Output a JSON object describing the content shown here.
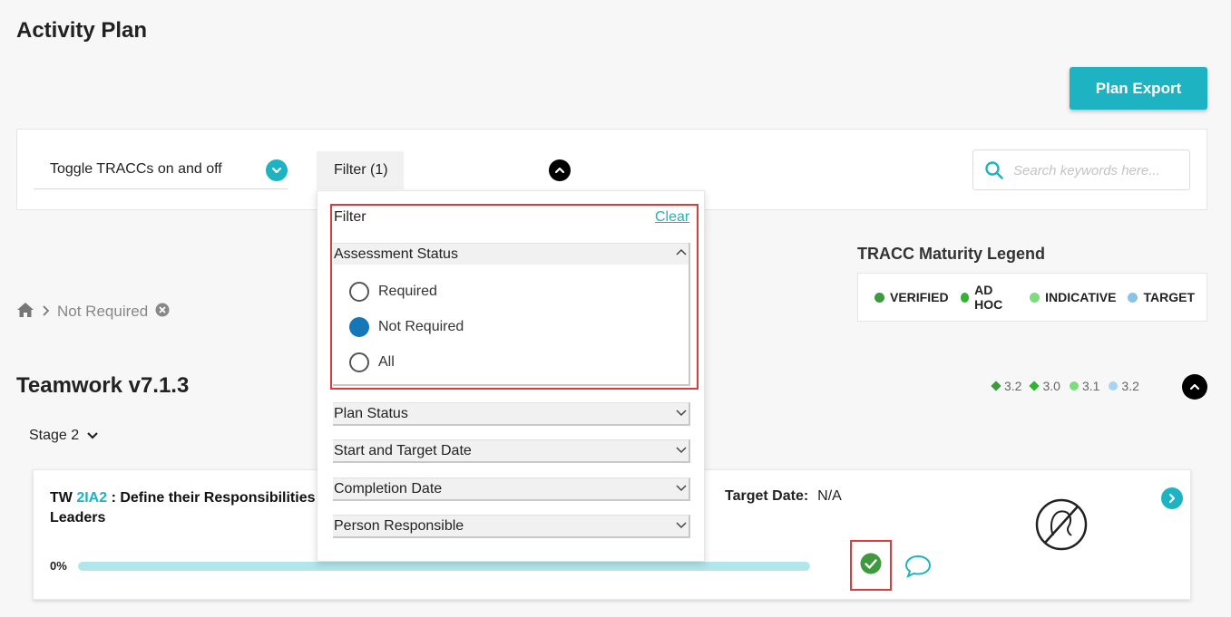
{
  "page": {
    "title": "Activity Plan",
    "export_label": "Plan Export"
  },
  "toolbar": {
    "toggle_label": "Toggle TRACCs on and off",
    "filter_label": "Filter (1)",
    "search_placeholder": "Search keywords here..."
  },
  "breadcrumb": {
    "current": "Not Required"
  },
  "legend": {
    "title": "TRACC Maturity Legend",
    "items": [
      {
        "label": "VERIFIED",
        "color": "#3f9a3f"
      },
      {
        "label": "AD HOC",
        "color": "#2fb52f"
      },
      {
        "label": "INDICATIVE",
        "color": "#7ddc7d"
      },
      {
        "label": "TARGET",
        "color": "#88c4ea"
      }
    ]
  },
  "section": {
    "title": "Teamwork v7.1.3",
    "scores": [
      {
        "value": "3.2",
        "color": "#3f9a3f"
      },
      {
        "value": "3.0",
        "color": "#2fb52f"
      },
      {
        "value": "3.1",
        "color": "#7ddc7d"
      },
      {
        "value": "3.2",
        "color": "#a7d4f2"
      }
    ],
    "stage_label": "Stage 2"
  },
  "card": {
    "prefix": "TW ",
    "code": "2IA2",
    "title_rest": " : Define their Responsibilities",
    "title_line2": "Leaders",
    "target_label": "Target Date:",
    "target_value": "N/A",
    "progress_label": "0%",
    "progress": 0
  },
  "filter_panel": {
    "title": "Filter",
    "clear_label": "Clear",
    "assessment_status": {
      "label": "Assessment Status",
      "options": [
        "Required",
        "Not Required",
        "All"
      ],
      "selected": "Not Required"
    },
    "sections": [
      "Plan Status",
      "Start and Target Date",
      "Completion Date",
      "Person Responsible"
    ]
  }
}
